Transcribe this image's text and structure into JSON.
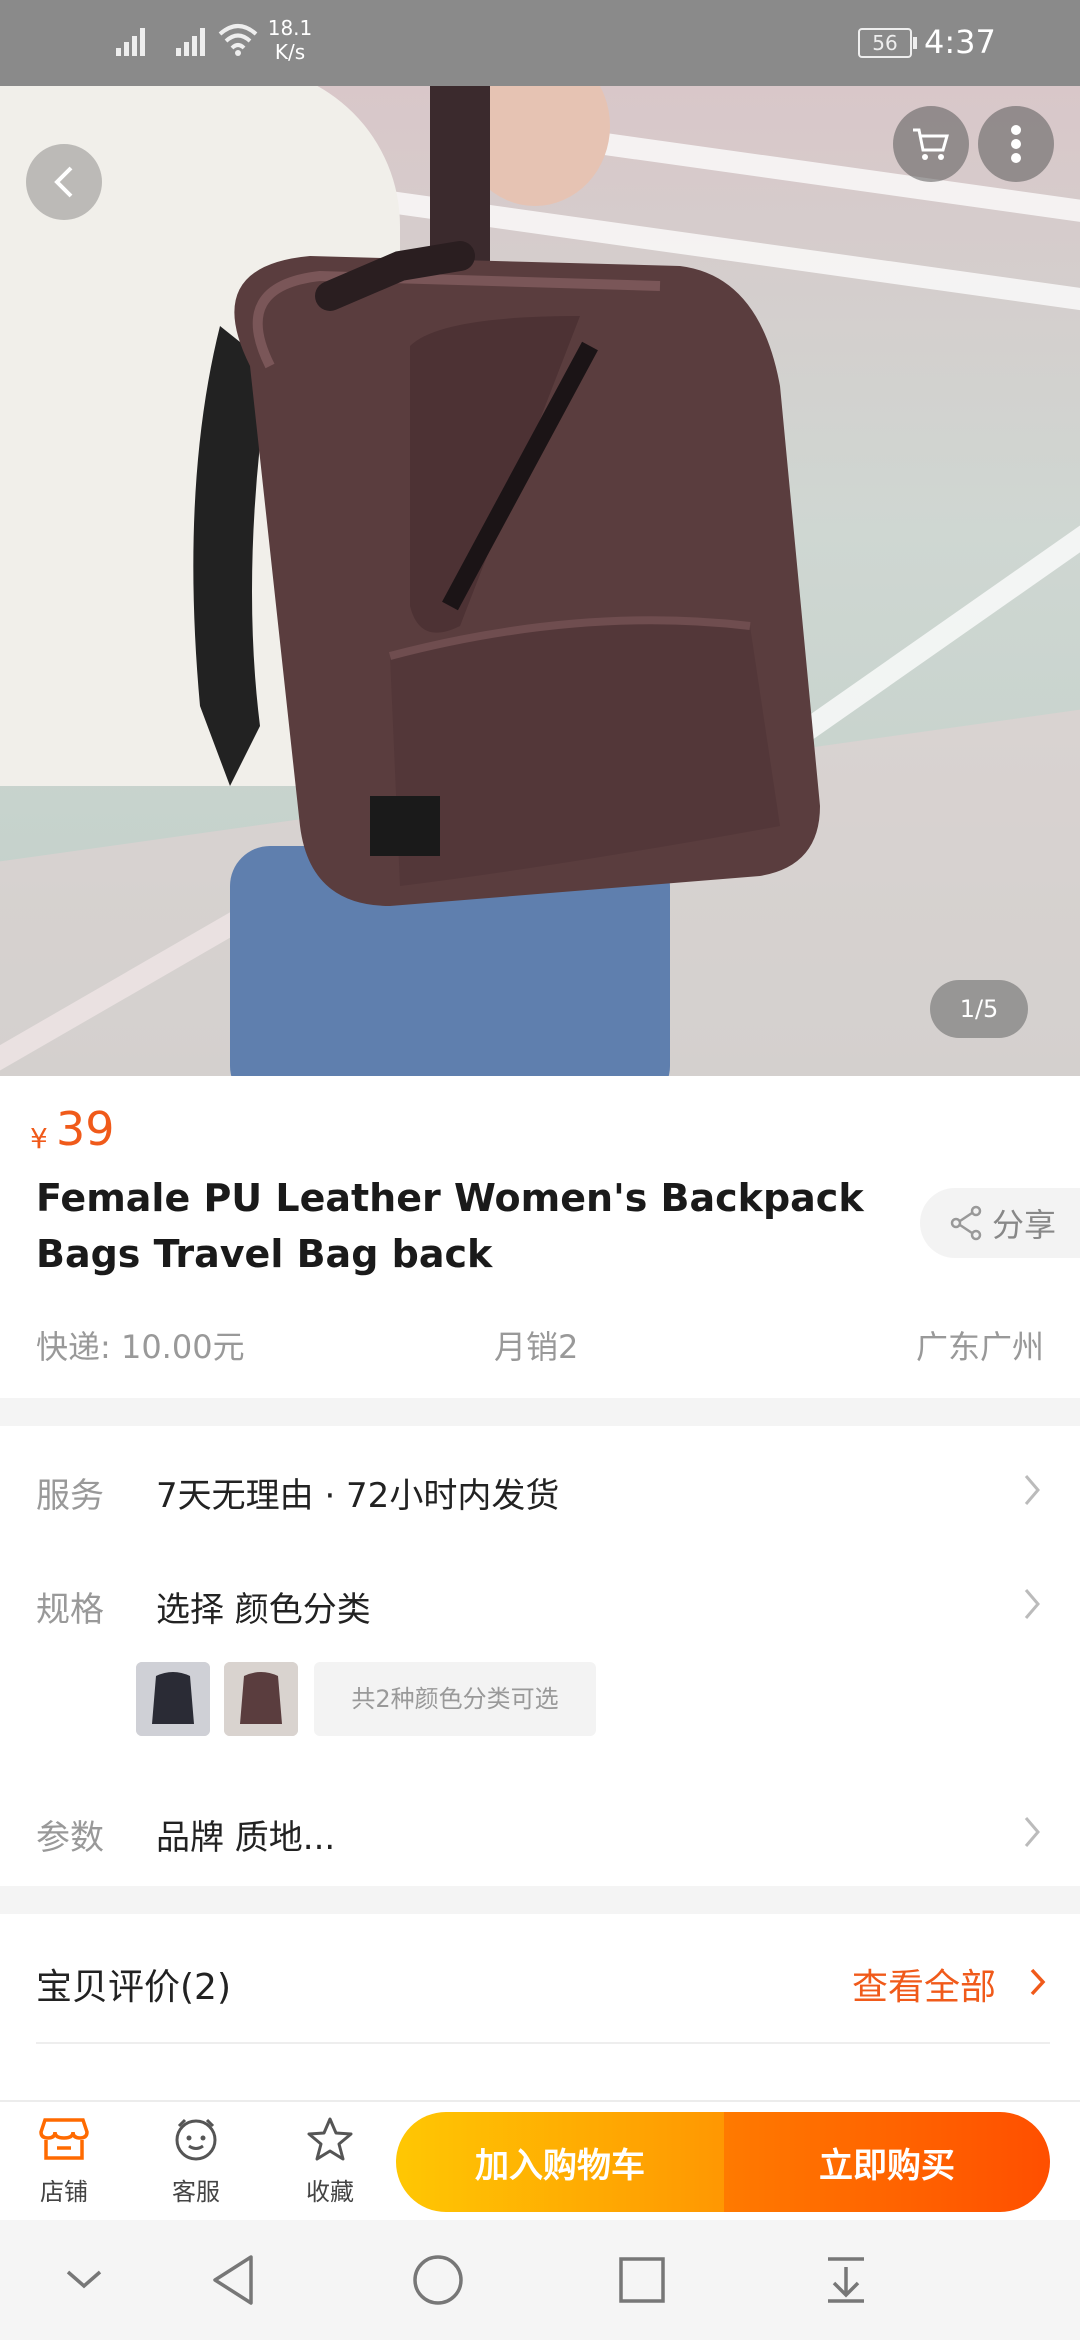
{
  "status_bar": {
    "net_speed": "18.1 K/s",
    "net_speed_value": "18.1",
    "net_speed_unit": "K/s",
    "battery": "56",
    "time": "4:37",
    "icons": [
      "signal-icon",
      "signal-icon",
      "wifi-icon",
      "battery-icon"
    ]
  },
  "product": {
    "image_counter": "1/5",
    "currency_symbol": "¥",
    "price": "39",
    "title": "Female PU Leather Women's Backpack Bags Travel Bag back",
    "share_label": "分享",
    "shipping": "快递: 10.00元",
    "monthly_sales": "月销2",
    "location": "广东广州"
  },
  "details": {
    "service_label": "服务",
    "service_value": "7天无理由 · 72小时内发货",
    "spec_label": "规格",
    "spec_value": "选择 颜色分类",
    "variant_hint": "共2种颜色分类可选",
    "params_label": "参数",
    "params_value": "品牌 质地..."
  },
  "reviews": {
    "title": "宝贝评价(2)",
    "view_all": "查看全部"
  },
  "action_bar": {
    "shop": "店铺",
    "service": "客服",
    "favorite": "收藏",
    "add_to_cart": "加入购物车",
    "buy_now": "立即购买"
  },
  "colors": {
    "accent": "#f05a1a",
    "cart_button": "#ffb703",
    "buy_button": "#ff5a00"
  }
}
